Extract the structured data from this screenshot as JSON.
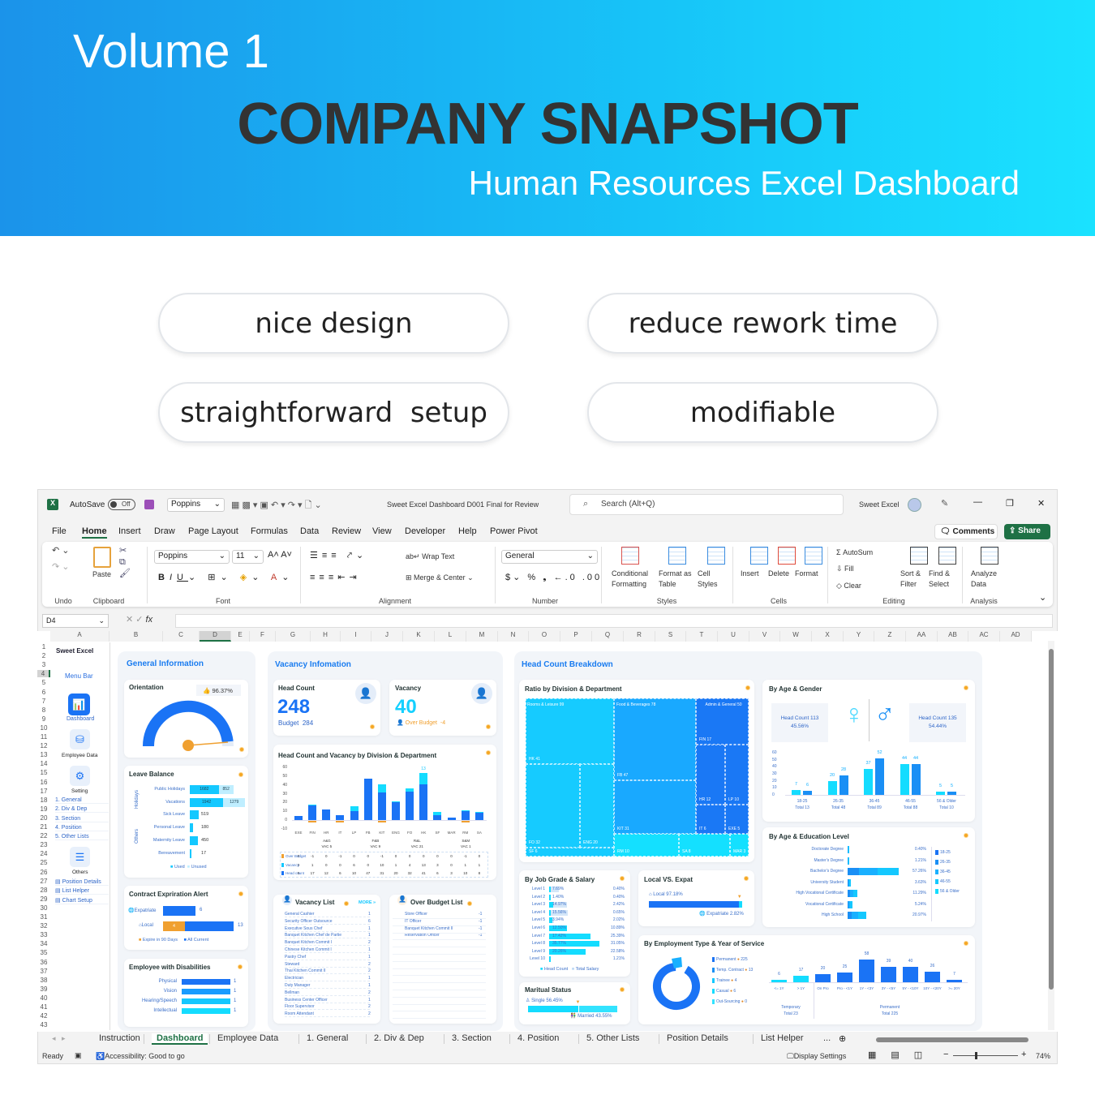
{
  "banner": {
    "volume": "Volume 1",
    "title": "COMPANY SNAPSHOT",
    "subtitle": "Human Resources Excel Dashboard"
  },
  "features": [
    "nice design",
    "reduce rework time",
    "straightforward  setup",
    "modifiable"
  ],
  "colors": {
    "banner_left": "#1b93ea",
    "banner_right": "#1ae2ff",
    "accent_blue": "#1a73f5",
    "accent_cyan": "#14dcff",
    "excel_green": "#1e7145",
    "gear_orange": "#f5a623"
  },
  "excel": {
    "titlebar": {
      "autosave": "AutoSave",
      "toggle": "Off",
      "font": "Poppins",
      "file": "Sweet Excel Dashboard D001 Final for Review",
      "search": "Search (Alt+Q)",
      "user": "Sweet Excel"
    },
    "menu": [
      "File",
      "Home",
      "Insert",
      "Draw",
      "Page Layout",
      "Formulas",
      "Data",
      "Review",
      "View",
      "Developer",
      "Help",
      "Power Pivot"
    ],
    "active_menu": "Home",
    "comments": "Comments",
    "share": "Share",
    "ribbon": {
      "groups": [
        "Undo",
        "Clipboard",
        "Font",
        "Alignment",
        "Number",
        "Styles",
        "Cells",
        "Editing",
        "Analysis"
      ],
      "paste": "Paste",
      "font": "Poppins",
      "size": "11",
      "wrap": "Wrap Text",
      "merge": "Merge & Center",
      "format": "General",
      "cond1": "Conditional",
      "cond2": "Formatting",
      "fat1": "Format as",
      "fat2": "Table",
      "cs1": "Cell",
      "cs2": "Styles",
      "insert": "Insert",
      "delete": "Delete",
      "formatc": "Format",
      "autosum": "AutoSum",
      "fill": "Fill",
      "clear": "Clear",
      "sort1": "Sort &",
      "sort2": "Filter",
      "find1": "Find &",
      "find2": "Select",
      "an1": "Analyze",
      "an2": "Data"
    },
    "namebox": "D4",
    "columns": [
      "A",
      "B",
      "C",
      "D",
      "E",
      "F",
      "G",
      "H",
      "I",
      "J",
      "K",
      "L",
      "M",
      "N",
      "O",
      "P",
      "Q",
      "R",
      "S",
      "T",
      "U",
      "V",
      "W",
      "X",
      "Y",
      "Z",
      "AA",
      "AB",
      "AC",
      "AD"
    ],
    "rows": [
      "1",
      "2",
      "3",
      "4",
      "5",
      "6",
      "7",
      "8",
      "9",
      "10",
      "11",
      "12",
      "13",
      "14",
      "15",
      "16",
      "17",
      "18",
      "19",
      "20",
      "21",
      "22",
      "23",
      "24",
      "25",
      "26",
      "27",
      "28",
      "29",
      "30",
      "31",
      "32",
      "33",
      "34",
      "35",
      "36",
      "37",
      "38",
      "39",
      "40",
      "41",
      "42",
      "43"
    ],
    "sheet_tabs": [
      "Instruction",
      "Dashboard",
      "Employee Data",
      "1. General",
      "2. Div & Dep",
      "3. Section",
      "4. Position",
      "5. Other Lists",
      "Position Details",
      "List Helper"
    ],
    "active_tab": "Dashboard",
    "more_tabs": "...",
    "status": {
      "ready": "Ready",
      "accessibility": "Accessibility: Good to go",
      "display": "Display Settings",
      "zoom": "74%"
    }
  },
  "dashboard": {
    "sidebar": {
      "brand": "Sweet Excel",
      "menu": "Menu Bar",
      "dashboard": "Dashboard",
      "employee": "Employee Data",
      "setting": "Setting",
      "settings": [
        "1. General",
        "2. Div & Dep",
        "3. Section",
        "4. Position",
        "5. Other Lists"
      ],
      "others": "Others",
      "other_items": [
        "Position Details",
        "List Helper",
        "Chart Setup"
      ]
    },
    "general": {
      "title": "General Information",
      "orientation": {
        "title": "Orientation",
        "value": "96.37%",
        "fraction": 0.9637
      },
      "leave": {
        "title": "Leave Balance",
        "group1": "Holidays",
        "group2": "Others",
        "legend_used": "Used",
        "legend_unused": "Unused",
        "items": [
          {
            "label": "Public Holidays",
            "used": "1682",
            "unused": "852"
          },
          {
            "label": "Vacations",
            "used": "1942",
            "unused": "1279"
          },
          {
            "label": "Sick Leave",
            "used": "519"
          },
          {
            "label": "Personal Leave",
            "used": "180"
          },
          {
            "label": "Maternity Leave",
            "used": "450"
          },
          {
            "label": "Bereavement",
            "used": "17"
          }
        ]
      },
      "contract": {
        "title": "Contract Expriration Alert",
        "expat": "Expatriate",
        "expat_val": "6",
        "local": "Local",
        "local_exp": "4",
        "local_val": "13",
        "legend1": "Expire in 90 Days",
        "legend2": "All Current"
      },
      "disab": {
        "title": "Employee with Disabilities",
        "items": [
          {
            "label": "Physical",
            "v": "1"
          },
          {
            "label": "Vision",
            "v": "1"
          },
          {
            "label": "Hearing/Speech",
            "v": "1"
          },
          {
            "label": "Intellectual",
            "v": "1"
          }
        ]
      }
    },
    "vacancy": {
      "title": "Vacancy Infomation",
      "headcount": {
        "title": "Head Count",
        "value": "248",
        "budget_label": "Budget",
        "budget": "284"
      },
      "vac": {
        "title": "Vacancy",
        "value": "40",
        "over_label": "Over Budget",
        "over": "-4"
      },
      "chart": {
        "title": "Head Count and Vacancy by Division & Department",
        "yticks": [
          "60",
          "50",
          "40",
          "30",
          "20",
          "10",
          "0",
          "-10"
        ],
        "categories": [
          "EXE",
          "FIN",
          "HR",
          "IT",
          "LP",
          "FB",
          "KIT",
          "ENG",
          "FO",
          "HK",
          "SF",
          "MAR",
          "RM",
          "SA"
        ],
        "divisions": [
          {
            "name": "A&G",
            "vac": "VAC 5"
          },
          {
            "name": "F&B",
            "vac": "VAC 9"
          },
          {
            "name": "R&L",
            "vac": "VAC 21"
          },
          {
            "name": "S&M",
            "vac": "VAC 1"
          }
        ],
        "row_labels": [
          "Over Budget",
          "Vacancy",
          "Head count"
        ],
        "over_budget": [
          0,
          -1,
          0,
          -1,
          0,
          0,
          -1,
          0,
          0,
          0,
          0,
          0,
          -1,
          0
        ],
        "vacancy": [
          0,
          1,
          0,
          0,
          6,
          0,
          10,
          1,
          4,
          13,
          3,
          0,
          1,
          1
        ],
        "head_count": [
          5,
          17,
          12,
          6,
          10,
          47,
          31,
          20,
          32,
          41,
          6,
          3,
          10,
          8
        ],
        "top_label": "13"
      },
      "vlist": {
        "title": "Vacancy List",
        "more": "MORE",
        "items": [
          [
            "General Cashier",
            "1"
          ],
          [
            "Security Officer Outsource",
            "6"
          ],
          [
            "Executive Sous Chef",
            "1"
          ],
          [
            "Banquet Kitchen Chef de Partie",
            "1"
          ],
          [
            "Banquet Kitchen Commit I",
            "2"
          ],
          [
            "Chinese Kitchen Commit I",
            "1"
          ],
          [
            "Pastry Chef",
            "1"
          ],
          [
            "Steward",
            "2"
          ],
          [
            "Thai Kitchen Commit II",
            "2"
          ],
          [
            "Electrician",
            "1"
          ],
          [
            "Duty Manager",
            "1"
          ],
          [
            "Bellman",
            "2"
          ],
          [
            "Business Center Officer",
            "1"
          ],
          [
            "Floor Supervisor",
            "2"
          ],
          [
            "Room Attendant",
            "2"
          ]
        ]
      },
      "oblist": {
        "title": "Over Budget List",
        "items": [
          [
            "Store Officer",
            "-1"
          ],
          [
            "IT Officer",
            "-1"
          ],
          [
            "Banquet Kitchen Commit II",
            "-1"
          ],
          [
            "Reservation Officer",
            "-1"
          ]
        ]
      }
    },
    "breakdown": {
      "title": "Head Count Breakdown",
      "treemap": {
        "title": "Ratio by Division & Department",
        "divisions": [
          "Rooms & Leisure 99",
          "Food & Beverages 78",
          "Admin & General 50"
        ],
        "cells": [
          "HK 41",
          "FO 32",
          "ENG 20",
          "SF 6",
          "FB 47",
          "KIT 31",
          "RM 10",
          "SA 8",
          "MAR 3",
          "FIN 17",
          "HR 12",
          "LP 10",
          "IT 6",
          "EXE 5"
        ]
      },
      "job": {
        "title": "By Job Grade & Salary",
        "legend1": "Head Count",
        "legend2": "Total Salary",
        "levels": [
          "Level 1",
          "Level 2",
          "Level 3",
          "Level 4",
          "Level 5",
          "Level 6",
          "Level 7",
          "Level 8",
          "Level 9",
          "Level 10"
        ],
        "head_pct": [
          "7.69%",
          "1.40%",
          "14.97%",
          "15.56%",
          "3.94%",
          "12.50%",
          "17.42%",
          "35.77%",
          "20.26%",
          ""
        ],
        "head": [
          0.4,
          0.4,
          2.42,
          0.65,
          2.02,
          10.89,
          25.39,
          31.05,
          22.58,
          1.21
        ],
        "salary_pct": [
          "0.40%",
          "0.40%",
          "2.42%",
          "0.65%",
          "2.02%",
          "10.89%",
          "25.39%",
          "31.05%",
          "22.58%",
          "1.21%"
        ],
        "salary": [
          7.69,
          1.4,
          14.97,
          15.56,
          3.94,
          12.5,
          17.42,
          35.77,
          20.26,
          0
        ]
      },
      "local": {
        "title": "Local VS. Expat",
        "local": "Local 97.18%",
        "expat": "Expatriate 2.82%",
        "local_frac": 0.9718
      },
      "marital": {
        "title": "Maritual Status",
        "single": "Single 56.45%",
        "married": "Married 43.55%",
        "single_frac": 0.5645
      },
      "age": {
        "title": "By Age & Gender",
        "female": "Head Count 113",
        "female_pct": "45.56%",
        "male": "Head Count 135",
        "male_pct": "54.44%",
        "yticks": [
          "60",
          "50",
          "40",
          "30",
          "20",
          "10",
          "0"
        ],
        "groups": [
          "18-25",
          "26-35",
          "36-45",
          "46-55",
          "56 & Older"
        ],
        "totals": [
          "Total 13",
          "Total 48",
          "Total 89",
          "Total 88",
          "Total 10"
        ],
        "female_vals": [
          7,
          20,
          37,
          44,
          5
        ],
        "male_vals": [
          6,
          28,
          52,
          44,
          5
        ]
      },
      "edu": {
        "title": "By Age & Education Level",
        "levels": [
          "Doctorate Degree",
          "Master's Degree",
          "Bachelor's Degree",
          "University Student",
          "High Vocational Certificate",
          "Vocational Certificate",
          "High School"
        ],
        "pct": [
          "0.40%",
          "1.21%",
          "57.26%",
          "3.63%",
          "11.29%",
          "5.24%",
          "20.97%"
        ],
        "values": [
          0.4,
          1.21,
          57.26,
          3.63,
          11.29,
          5.24,
          20.97
        ],
        "legend": [
          "18-25",
          "26-35",
          "36-45",
          "46-55",
          "56 & Older"
        ]
      },
      "emp": {
        "title": "By Employment Type & Year of Service",
        "legend": [
          "Permanent",
          "Temp. Contract",
          "Trainee",
          "Casual",
          "Out-Sourcing"
        ],
        "legend_vals": [
          "225",
          "13",
          "4",
          "6",
          "0"
        ],
        "categories": [
          "<= 1Y",
          "> 1Y",
          "On Pro",
          "Pro - <1Y",
          "1Y - <3Y",
          "3Y - <5Y",
          "5Y - <10Y",
          "10Y - <20Y",
          ">= 20Y"
        ],
        "values": [
          6,
          17,
          20,
          25,
          58,
          39,
          40,
          26,
          7
        ],
        "temp": "Temporary",
        "temp_total": "Total 23",
        "perm": "Permanent",
        "perm_total": "Total 225"
      }
    }
  }
}
